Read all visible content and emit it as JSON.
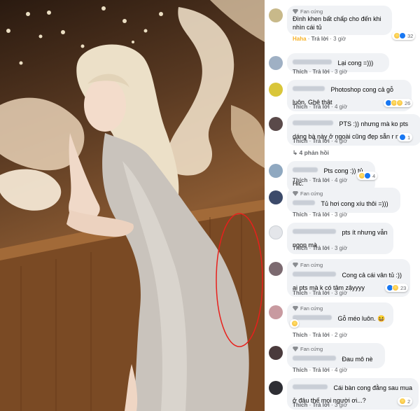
{
  "comments": [
    {
      "badge": "Fan cứng",
      "text": "Đình khen bất chấp cho đến khi nhìn cái tủ",
      "actions": {
        "reaction": "Haha",
        "reply": "Trả lời",
        "time": "3 giờ"
      },
      "reacts": {
        "count": "32"
      }
    },
    {
      "text": "Lại cong =)))",
      "actions": {
        "like": "Thích",
        "reply": "Trả lời",
        "time": "3 giờ"
      }
    },
    {
      "text": "Photoshop cong cả gỗ luôn. Ghê thật",
      "actions": {
        "like": "Thích",
        "reply": "Trả lời",
        "time": "4 giờ"
      },
      "reacts": {
        "count": "26"
      }
    },
    {
      "text": "PTS :)) nhưng mà ko pts dáng bà này ở ngoài cũng đẹp sẵn r mà",
      "actions": {
        "like": "Thích",
        "reply": "Trả lời",
        "time": "4 giờ"
      },
      "reacts": {
        "count": "1"
      },
      "replies": "4 phản hồi"
    },
    {
      "text": "Pts cong :)) tủ. Hic.",
      "actions": {
        "like": "Thích",
        "reply": "Trả lời",
        "time": "4 giờ"
      },
      "reacts": {
        "count": "4"
      }
    },
    {
      "badge": "Fan cứng",
      "text": "Tủ hơi cong xíu thôi =)))",
      "actions": {
        "like": "Thích",
        "reply": "Trả lời",
        "time": "3 giờ"
      }
    },
    {
      "text": "pts ít nhưng vẫn ngon mà",
      "actions": {
        "like": "Thích",
        "reply": "Trả lời",
        "time": "3 giờ"
      }
    },
    {
      "badge": "Fan cứng",
      "text": "Cong cả cái vân tủ :)) ai pts mà k có tâm zậyyyy",
      "actions": {
        "like": "Thích",
        "reply": "Trả lời",
        "time": "3 giờ"
      },
      "reacts": {
        "count": "23"
      }
    },
    {
      "badge": "Fan cứng",
      "text": "Gỗ méo luôn. 😆",
      "actions": {
        "like": "Thích",
        "reply": "Trả lời",
        "time": "2 giờ"
      }
    },
    {
      "text": "Đau mô nè",
      "actions": {
        "like": "Thích",
        "reply": "Trả lời",
        "time": "4 giờ"
      }
    },
    {
      "text": "Cái bàn cong đằng sau mua ở đâu thế mọi người ơi...?",
      "actions": {
        "like": "Thích",
        "reply": "Trả lời",
        "time": "3 giờ"
      },
      "reacts": {
        "count": "2"
      }
    }
  ]
}
